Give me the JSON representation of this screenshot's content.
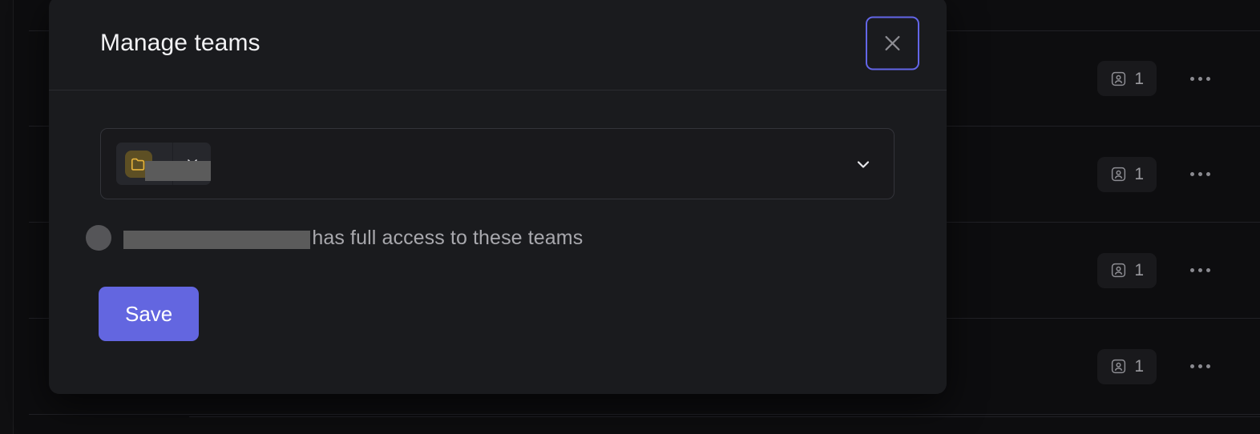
{
  "modal": {
    "title": "Manage teams",
    "close_icon": "close-icon",
    "select": {
      "chevron_icon": "chevron-down-icon",
      "chips": [
        {
          "avatar_icon": "folder-icon",
          "label": "",
          "remove_icon": "close-icon",
          "avatar_color": "#5d4f24",
          "redacted": true
        }
      ]
    },
    "access_note": {
      "avatar_icon": "avatar-placeholder-icon",
      "redacted_name": "",
      "text": "has full access to these teams"
    },
    "save_label": "Save",
    "save_color": "#6366e0",
    "focus_ring_color": "#6366e8"
  },
  "background": {
    "rows": [
      {
        "member_icon": "contact-card-icon",
        "member_count": "1",
        "menu_icon": "kebab-menu-icon"
      },
      {
        "member_icon": "contact-card-icon",
        "member_count": "1",
        "menu_icon": "kebab-menu-icon"
      },
      {
        "member_icon": "contact-card-icon",
        "member_count": "1",
        "menu_icon": "kebab-menu-icon"
      },
      {
        "member_icon": "contact-card-icon",
        "member_count": "1",
        "menu_icon": "kebab-menu-icon"
      }
    ]
  }
}
